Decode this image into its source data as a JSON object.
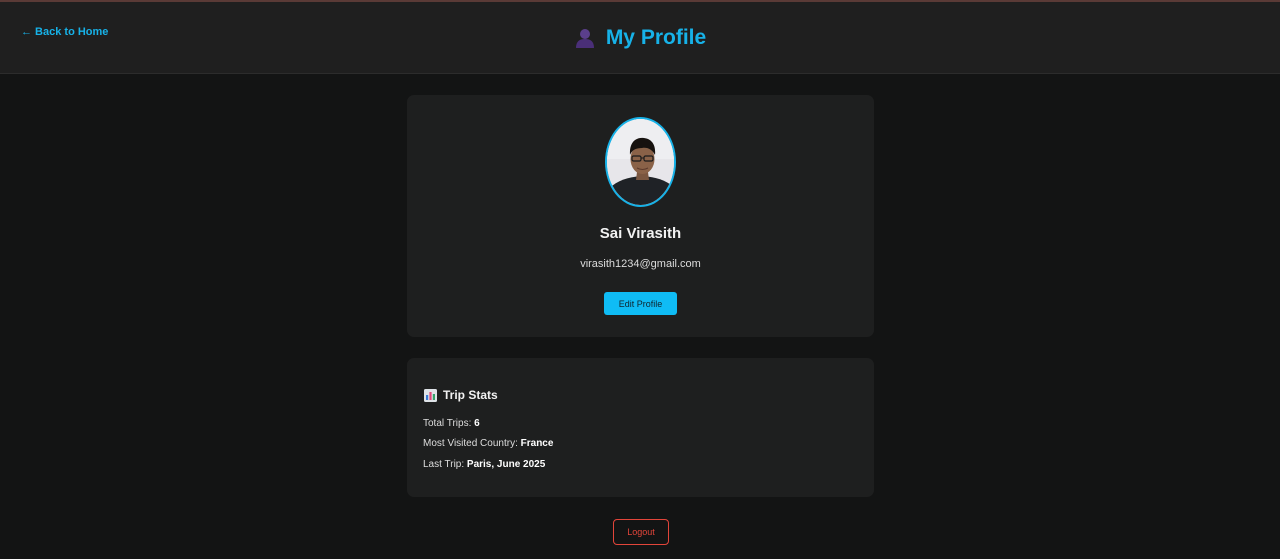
{
  "header": {
    "back_label": "← Back to Home",
    "title": "My Profile",
    "title_icon": "person-icon"
  },
  "profile": {
    "name": "Sai Virasith",
    "email": "virasith1234@gmail.com",
    "edit_label": "Edit Profile",
    "avatar": "profile-photo"
  },
  "stats": {
    "heading": "Trip Stats",
    "heading_icon": "bar-chart-icon",
    "rows": [
      {
        "label": "Total Trips: ",
        "value": "6"
      },
      {
        "label": "Most Visited Country: ",
        "value": "France"
      },
      {
        "label": "Last Trip: ",
        "value": "Paris, June 2025"
      }
    ]
  },
  "logout_label": "Logout",
  "colors": {
    "accent": "#17b2e8",
    "button": "#0fbcf5",
    "danger": "#e2453a",
    "background": "#131414",
    "card": "#1e1f1f"
  }
}
